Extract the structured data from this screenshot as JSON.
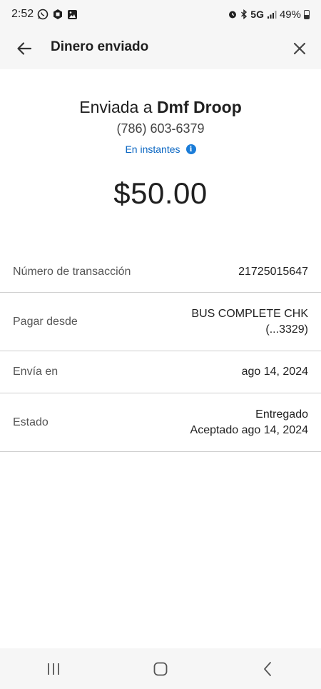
{
  "status_bar": {
    "time": "2:52",
    "network": "5G",
    "battery": "49%"
  },
  "header": {
    "title": "Dinero enviado"
  },
  "summary": {
    "sent_prefix": "Enviada a",
    "recipient": "Dmf Droop",
    "phone": "(786) 603-6379",
    "speed": "En instantes",
    "amount": "$50.00"
  },
  "details": {
    "transaction": {
      "label": "Número de transacción",
      "value": "21725015647"
    },
    "pay_from": {
      "label": "Pagar desde",
      "value_line1": "BUS COMPLETE CHK",
      "value_line2": "(...3329)"
    },
    "send_on": {
      "label": "Envía en",
      "value": "ago 14, 2024"
    },
    "status": {
      "label": "Estado",
      "value_line1": "Entregado",
      "value_line2": "Aceptado ago 14, 2024"
    }
  },
  "icons": {
    "back": "arrow-left-icon",
    "close": "close-icon",
    "info": "info-icon",
    "nav_recents": "recents-icon",
    "nav_home": "home-icon",
    "nav_back": "chevron-left-icon"
  },
  "colors": {
    "accent": "#0a66c2",
    "info": "#1a7cd8",
    "bar_background": "#f6f6f6"
  }
}
